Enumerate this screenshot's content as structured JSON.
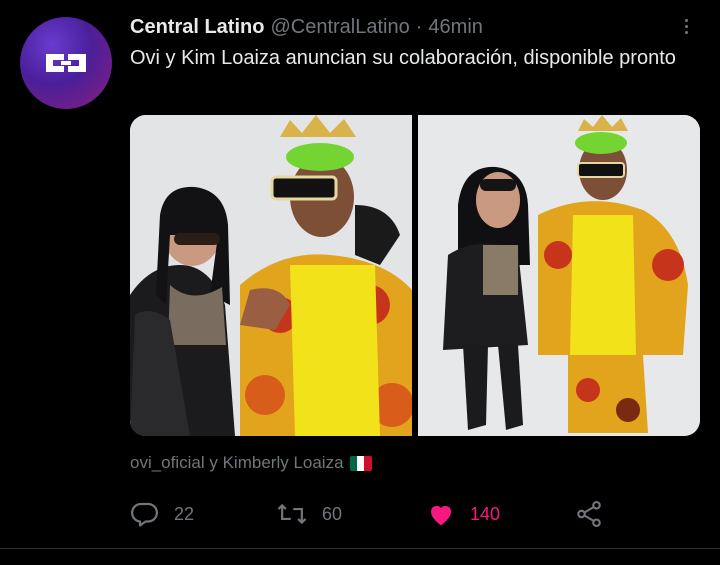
{
  "tweet": {
    "author_name": "Central Latino",
    "author_handle": "@CentralLatino",
    "separator": "·",
    "time": "46min",
    "text": "Ovi y Kim Loaiza anuncian su colaboración, disponible pronto",
    "tagged_users": "ovi_oficial y Kimberly Loaiza",
    "flag_icon": "mexico-flag-icon"
  },
  "stats": {
    "replies": "22",
    "retweets": "60",
    "likes": "140"
  },
  "colors": {
    "background": "#000000",
    "text": "#e7e9ea",
    "muted": "#71767b",
    "like": "#f91880",
    "avatar_gradient": [
      "#6a3bd0",
      "#8a1f7a"
    ]
  },
  "icons": {
    "more": "more-dots-icon",
    "reply": "reply-icon",
    "retweet": "retweet-icon",
    "like": "heart-icon",
    "share": "share-icon"
  }
}
